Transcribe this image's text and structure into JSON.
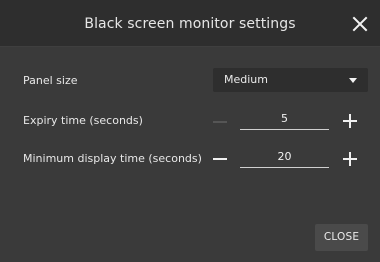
{
  "dialog": {
    "title": "Black screen monitor settings",
    "close_icon": "close-icon"
  },
  "settings": {
    "panel_size": {
      "label": "Panel size",
      "value": "Medium",
      "icon": "caret-down-icon"
    },
    "expiry_time": {
      "label": "Expiry time (seconds)",
      "value": "5",
      "minus_disabled": true
    },
    "min_display_time": {
      "label": "Minimum display time (seconds)",
      "value": "20",
      "minus_disabled": false
    }
  },
  "footer": {
    "close_label": "CLOSE"
  },
  "colors": {
    "background": "#3a3a3a",
    "titlebar": "#2e2e2e",
    "text": "#e8e8e8",
    "disabled": "#555555",
    "button": "#4a4a4a"
  }
}
